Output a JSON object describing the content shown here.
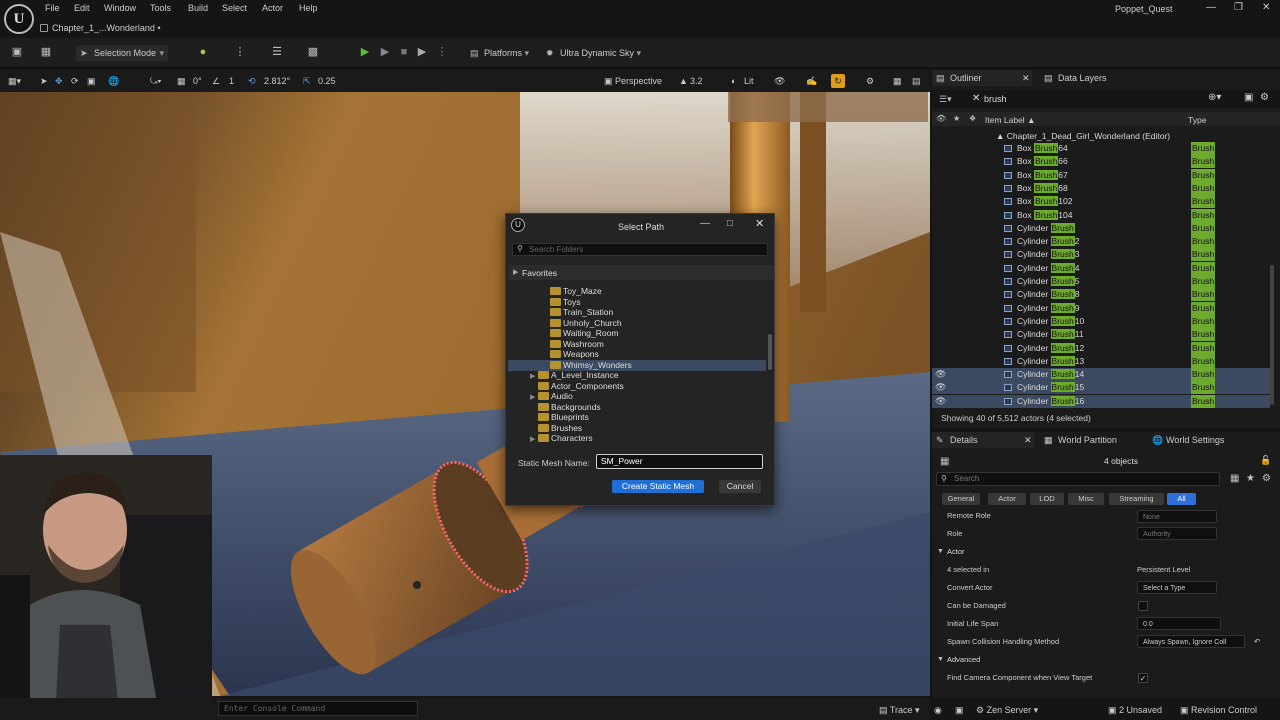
{
  "menubar": {
    "items": [
      "File",
      "Edit",
      "Window",
      "Tools",
      "Build",
      "Select",
      "Actor",
      "Help"
    ],
    "level_tab": "Chapter_1_...Wonderland •",
    "project": "Poppet_Quest"
  },
  "toolbar": {
    "mode": "Selection Mode",
    "platforms": "Platforms",
    "sky": "Ultra Dynamic Sky"
  },
  "viewport_bar": {
    "angle_snap": "0°",
    "grid": "1",
    "scale": "2.812°",
    "scale_snap": "0.25",
    "perspective": "Perspective",
    "fov": "3.2",
    "view_mode": "Lit"
  },
  "console": {
    "placeholder": "Enter Console Command",
    "trace": "Trace",
    "server": "Zen Server",
    "unsaved": "2 Unsaved",
    "revision": "Revision Control"
  },
  "outliner": {
    "tab": "Outliner",
    "tab2": "Data Layers",
    "search": "brush",
    "col_label": "Item Label",
    "col_type": "Type",
    "root": "Chapter_1_Dead_Girl_Wonderland (Editor)",
    "rows": [
      {
        "pre": "Box ",
        "hl": "Brush",
        "post": "64",
        "type": "Brush",
        "sel": false
      },
      {
        "pre": "Box ",
        "hl": "Brush",
        "post": "66",
        "type": "Brush",
        "sel": false
      },
      {
        "pre": "Box ",
        "hl": "Brush",
        "post": "67",
        "type": "Brush",
        "sel": false
      },
      {
        "pre": "Box ",
        "hl": "Brush",
        "post": "68",
        "type": "Brush",
        "sel": false
      },
      {
        "pre": "Box ",
        "hl": "Brush",
        "post": "102",
        "type": "Brush",
        "sel": false
      },
      {
        "pre": "Box ",
        "hl": "Brush",
        "post": "104",
        "type": "Brush",
        "sel": false
      },
      {
        "pre": "Cylinder ",
        "hl": "Brush",
        "post": "",
        "type": "Brush",
        "sel": false
      },
      {
        "pre": "Cylinder ",
        "hl": "Brush",
        "post": "2",
        "type": "Brush",
        "sel": false
      },
      {
        "pre": "Cylinder ",
        "hl": "Brush",
        "post": "3",
        "type": "Brush",
        "sel": false
      },
      {
        "pre": "Cylinder ",
        "hl": "Brush",
        "post": "4",
        "type": "Brush",
        "sel": false
      },
      {
        "pre": "Cylinder ",
        "hl": "Brush",
        "post": "5",
        "type": "Brush",
        "sel": false
      },
      {
        "pre": "Cylinder ",
        "hl": "Brush",
        "post": "8",
        "type": "Brush",
        "sel": false
      },
      {
        "pre": "Cylinder ",
        "hl": "Brush",
        "post": "9",
        "type": "Brush",
        "sel": false
      },
      {
        "pre": "Cylinder ",
        "hl": "Brush",
        "post": "10",
        "type": "Brush",
        "sel": false
      },
      {
        "pre": "Cylinder ",
        "hl": "Brush",
        "post": "11",
        "type": "Brush",
        "sel": false
      },
      {
        "pre": "Cylinder ",
        "hl": "Brush",
        "post": "12",
        "type": "Brush",
        "sel": false
      },
      {
        "pre": "Cylinder ",
        "hl": "Brush",
        "post": "13",
        "type": "Brush",
        "sel": false
      },
      {
        "pre": "Cylinder ",
        "hl": "Brush",
        "post": "14",
        "type": "Brush",
        "sel": true
      },
      {
        "pre": "Cylinder ",
        "hl": "Brush",
        "post": "15",
        "type": "Brush",
        "sel": true
      },
      {
        "pre": "Cylinder ",
        "hl": "Brush",
        "post": "16",
        "type": "Brush",
        "sel": true
      }
    ],
    "status": "Showing 40 of 5,512 actors (4 selected)"
  },
  "details": {
    "tab": "Details",
    "tab2": "World Partition",
    "tab3": "World Settings",
    "count": "4 objects",
    "search_placeholder": "Search",
    "filters": [
      "General",
      "Actor",
      "LOD",
      "Misc",
      "Streaming",
      "All"
    ],
    "remote_role_label": "Remote Role",
    "remote_role": "None",
    "role_label": "Role",
    "role": "Authority",
    "cat_actor": "Actor",
    "selected_in_label": "4 selected in",
    "selected_in": "Persistent Level",
    "convert_label": "Convert Actor",
    "convert": "Select a Type",
    "damaged_label": "Can be Damaged",
    "lifespan_label": "Initial Life Span",
    "lifespan": "0.0",
    "spawn_label": "Spawn Collision Handling Method",
    "spawn": "Always Spawn, Ignore Coll",
    "cat_advanced": "Advanced",
    "camera_label": "Find Camera Component when View Target"
  },
  "dialog": {
    "title": "Select Path",
    "search_placeholder": "Search Folders",
    "favorites": "Favorites",
    "folders": [
      {
        "name": "Toy_Maze",
        "indent": 1,
        "arrow": false,
        "sel": false
      },
      {
        "name": "Toys",
        "indent": 1,
        "arrow": false,
        "sel": false
      },
      {
        "name": "Train_Station",
        "indent": 1,
        "arrow": false,
        "sel": false
      },
      {
        "name": "Unholy_Church",
        "indent": 1,
        "arrow": false,
        "sel": false
      },
      {
        "name": "Waiting_Room",
        "indent": 1,
        "arrow": false,
        "sel": false
      },
      {
        "name": "Washroom",
        "indent": 1,
        "arrow": false,
        "sel": false
      },
      {
        "name": "Weapons",
        "indent": 1,
        "arrow": false,
        "sel": false
      },
      {
        "name": "Whimsy_Wonders",
        "indent": 1,
        "arrow": false,
        "sel": true
      },
      {
        "name": "A_Level_Instance",
        "indent": 0,
        "arrow": true,
        "sel": false
      },
      {
        "name": "Actor_Components",
        "indent": 0,
        "arrow": false,
        "sel": false
      },
      {
        "name": "Audio",
        "indent": 0,
        "arrow": true,
        "sel": false
      },
      {
        "name": "Backgrounds",
        "indent": 0,
        "arrow": false,
        "sel": false
      },
      {
        "name": "Blueprints",
        "indent": 0,
        "arrow": false,
        "sel": false
      },
      {
        "name": "Brushes",
        "indent": 0,
        "arrow": false,
        "sel": false
      },
      {
        "name": "Characters",
        "indent": 0,
        "arrow": true,
        "sel": false
      }
    ],
    "name_label": "Static Mesh Name:",
    "name_value": "SM_Power",
    "create": "Create Static Mesh",
    "cancel": "Cancel"
  }
}
